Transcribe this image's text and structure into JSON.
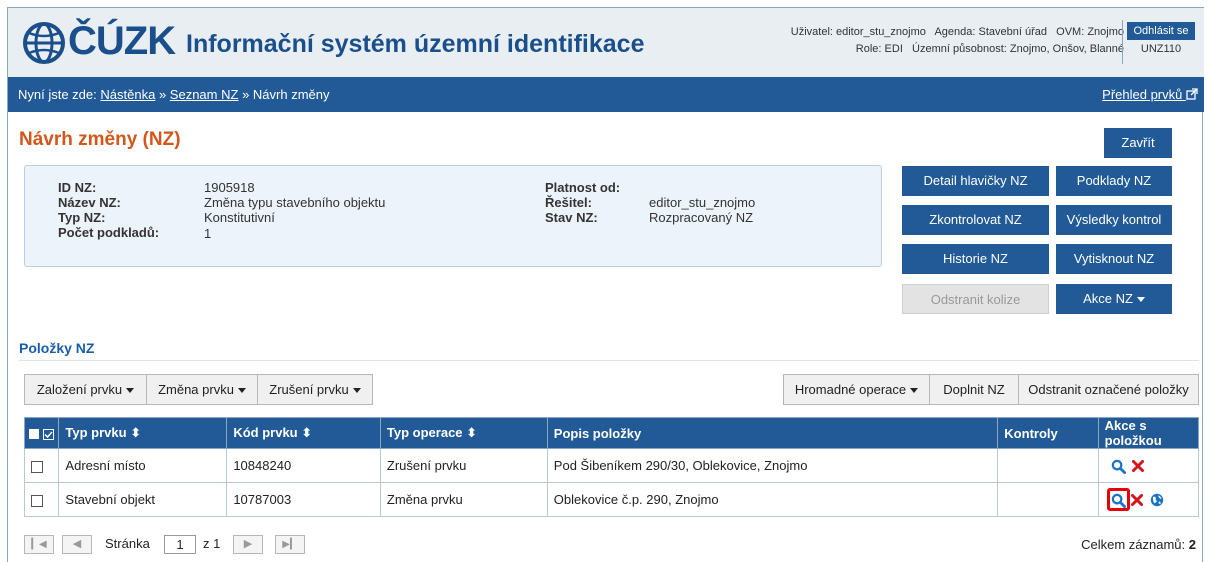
{
  "header": {
    "logo_text": "ČÚZK",
    "app_title": "Informační systém územní identifikace",
    "user_line1": "Uživatel: editor_stu_znojmo   Agenda: Stavební úřad   OVM: Znojmo",
    "user_line2": "Role: EDI   Územní působnost: Znojmo, Onšov, Blanné",
    "logout_label": "Odhlásit se",
    "code": "UNZ110"
  },
  "breadcrumb": {
    "prefix": "Nyní jste zde:",
    "items": [
      "Nástěnka",
      "Seznam NZ",
      "Návrh změny"
    ],
    "separator": "»",
    "overview_link": "Přehled prvků"
  },
  "page": {
    "title": "Návrh změny (NZ)",
    "close_label": "Zavřít"
  },
  "info": {
    "id_label": "ID NZ:",
    "id_value": "1905918",
    "name_label": "Název NZ:",
    "name_value": "Změna typu stavebního objektu",
    "type_label": "Typ NZ:",
    "type_value": "Konstitutivní",
    "count_label": "Počet podkladů:",
    "count_value": "1",
    "valid_label": "Platnost od:",
    "valid_value": "",
    "solver_label": "Řešitel:",
    "solver_value": "editor_stu_znojmo",
    "state_label": "Stav NZ:",
    "state_value": "Rozpracovaný NZ"
  },
  "actions": {
    "detail": "Detail hlavičky NZ",
    "sources": "Podklady NZ",
    "check": "Zkontrolovat NZ",
    "results": "Výsledky kontrol",
    "history": "Historie NZ",
    "print": "Vytisknout NZ",
    "remove_collisions": "Odstranit kolize",
    "actions_nz": "Akce NZ"
  },
  "items_section": {
    "title": "Položky NZ",
    "create": "Založení prvku",
    "change": "Změna prvku",
    "cancel": "Zrušení prvku",
    "bulk": "Hromadné operace",
    "fill": "Doplnit NZ",
    "remove_marked": "Odstranit označené položky"
  },
  "table": {
    "columns": [
      "Typ prvku",
      "Kód prvku",
      "Typ operace",
      "Popis položky",
      "Kontroly",
      "Akce s položkou"
    ],
    "rows": [
      {
        "type": "Adresní místo",
        "code": "10848240",
        "operation": "Zrušení prvku",
        "desc": "Pod Šibeníkem 290/30, Oblekovice, Znojmo",
        "checks": ""
      },
      {
        "type": "Stavební objekt",
        "code": "10787003",
        "operation": "Změna prvku",
        "desc": "Oblekovice č.p. 290, Znojmo",
        "checks": ""
      }
    ]
  },
  "pager": {
    "page_label": "Stránka",
    "page_value": "1",
    "of_label": "z 1",
    "total_label": "Celkem záznamů:",
    "total_value": "2"
  },
  "colors": {
    "brand": "#215a96",
    "title_orange": "#d1571b",
    "highlight": "#e6000a"
  }
}
